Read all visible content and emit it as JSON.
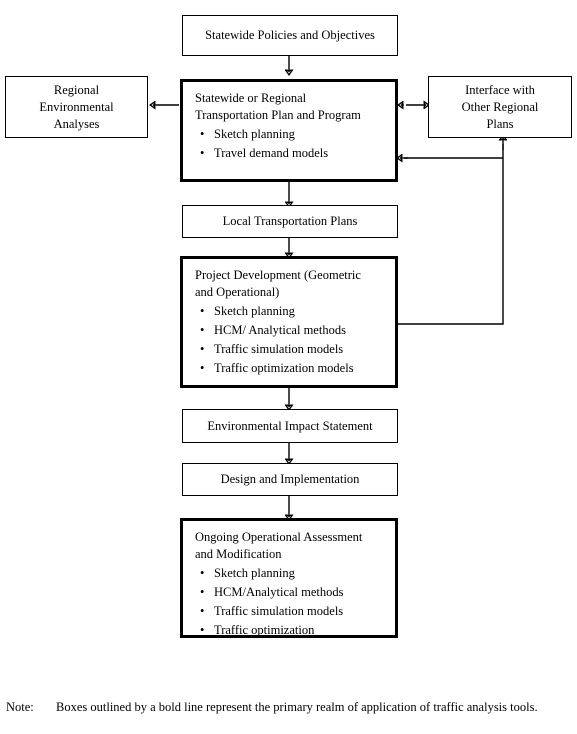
{
  "diagram": {
    "title": "Traffic analysis tools application flowchart",
    "accent_color": "#000000",
    "background_color": "#ffffff",
    "boxes": {
      "statewide_policies": {
        "label": "Statewide Policies and Objectives",
        "style": "thin"
      },
      "regional_environmental": {
        "label": "Regional\nEnvironmental\nAnalyses",
        "style": "thin"
      },
      "statewide_plan": {
        "title": "Statewide or Regional\nTransportation Plan and Program",
        "style": "bold",
        "bullets": [
          "Sketch planning",
          "Travel demand models"
        ]
      },
      "interface_regional": {
        "label": "Interface with\nOther Regional\nPlans",
        "style": "thin"
      },
      "local_plans": {
        "label": "Local Transportation Plans",
        "style": "thin"
      },
      "project_development": {
        "title": "Project Development (Geometric\nand Operational)",
        "style": "bold",
        "bullets": [
          "Sketch planning",
          "HCM/ Analytical methods",
          "Traffic simulation models",
          "Traffic optimization models"
        ]
      },
      "environmental_impact": {
        "label": "Environmental Impact Statement",
        "style": "thin"
      },
      "design_implementation": {
        "label": "Design and Implementation",
        "style": "thin"
      },
      "ongoing_assessment": {
        "title": "Ongoing Operational Assessment\nand Modification",
        "style": "bold",
        "bullets": [
          "Sketch planning",
          "HCM/Analytical methods",
          "Traffic simulation models",
          "Traffic optimization"
        ]
      }
    },
    "note": {
      "label": "Note:",
      "text": "Boxes outlined by a bold line represent the primary realm of application of traffic analysis tools."
    }
  }
}
